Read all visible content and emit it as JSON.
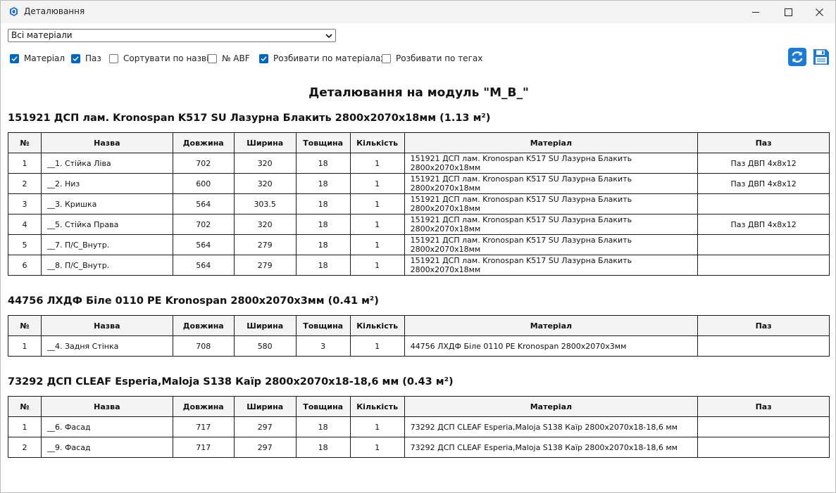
{
  "window": {
    "title": "Деталювання"
  },
  "toolbar": {
    "material_filter_value": "Всі матеріали",
    "checkboxes": [
      {
        "label": "Матеріал",
        "checked": true
      },
      {
        "label": "Паз",
        "checked": true
      },
      {
        "label": "Сортувати по назві",
        "checked": false
      },
      {
        "label": "№ ABF",
        "checked": false
      },
      {
        "label": "Розбивати по матеріалах",
        "checked": true
      },
      {
        "label": "Розбивати по тегах",
        "checked": false
      }
    ],
    "refresh_icon": "refresh-icon",
    "save_icon": "floppy-disk-icon"
  },
  "report": {
    "heading": "Деталювання на модуль \"M_B_\"",
    "columns": [
      "№",
      "Назва",
      "Довжина",
      "Ширина",
      "Товщина",
      "Кількість",
      "Матеріал",
      "Паз"
    ],
    "sections": [
      {
        "title": "151921 ДСП лам. Kronospan K517 SU Лазурна Блакить 2800x2070x18мм (1.13 м²)",
        "rows": [
          [
            "1",
            "__1. Стійка Ліва",
            "702",
            "320",
            "18",
            "1",
            "151921 ДСП лам. Kronospan K517 SU Лазурна Блакить 2800x2070x18мм",
            "Паз ДВП 4x8x12"
          ],
          [
            "2",
            "__2. Низ",
            "600",
            "320",
            "18",
            "1",
            "151921 ДСП лам. Kronospan K517 SU Лазурна Блакить 2800x2070x18мм",
            "Паз ДВП 4x8x12"
          ],
          [
            "3",
            "__3. Кришка",
            "564",
            "303.5",
            "18",
            "1",
            "151921 ДСП лам. Kronospan K517 SU Лазурна Блакить 2800x2070x18мм",
            ""
          ],
          [
            "4",
            "__5. Стійка Права",
            "702",
            "320",
            "18",
            "1",
            "151921 ДСП лам. Kronospan K517 SU Лазурна Блакить 2800x2070x18мм",
            "Паз ДВП 4x8x12"
          ],
          [
            "5",
            "__7. П/С_Внутр.",
            "564",
            "279",
            "18",
            "1",
            "151921 ДСП лам. Kronospan K517 SU Лазурна Блакить 2800x2070x18мм",
            ""
          ],
          [
            "6",
            "__8. П/С_Внутр.",
            "564",
            "279",
            "18",
            "1",
            "151921 ДСП лам. Kronospan K517 SU Лазурна Блакить 2800x2070x18мм",
            ""
          ]
        ]
      },
      {
        "title": "44756 ЛХДФ Біле 0110 PE Kronospan 2800x2070x3мм (0.41 м²)",
        "rows": [
          [
            "1",
            "__4. Задня Стінка",
            "708",
            "580",
            "3",
            "1",
            "44756 ЛХДФ Біле 0110 PE Kronospan 2800x2070x3мм",
            ""
          ]
        ]
      },
      {
        "title": "73292 ДСП CLEAF Esperia,Maloja S138 Каїр 2800x2070x18-18,6 мм (0.43 м²)",
        "rows": [
          [
            "1",
            "__6. Фасад",
            "717",
            "297",
            "18",
            "1",
            "73292 ДСП CLEAF Esperia,Maloja S138 Каїр 2800x2070x18-18,6 мм",
            ""
          ],
          [
            "2",
            "__9. Фасад",
            "717",
            "297",
            "18",
            "1",
            "73292 ДСП CLEAF Esperia,Maloja S138 Каїр 2800x2070x18-18,6 мм",
            ""
          ]
        ]
      }
    ]
  },
  "colors": {
    "accent": "#0067c0",
    "titlebar": "#f3f3f3",
    "header_bg": "#f4f4f4"
  }
}
